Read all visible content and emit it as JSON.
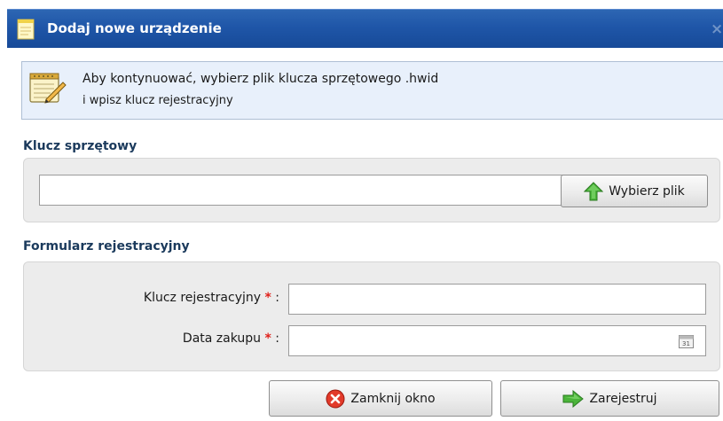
{
  "dialog": {
    "title": "Dodaj nowe urządzenie",
    "close_glyph": "×"
  },
  "info": {
    "line1": "Aby kontynuować, wybierz plik klucza sprzętowego .hwid",
    "line2": "i wpisz klucz rejestracyjny",
    "icon": "notepad-pencil-icon"
  },
  "hardware_key": {
    "section_title": "Klucz sprzętowy",
    "file_value": "",
    "choose_file_label": "Wybierz plik",
    "choose_file_icon": "green-up-arrow-icon"
  },
  "registration": {
    "section_title": "Formularz rejestracyjny",
    "key_label": "Klucz rejestracyjny",
    "key_value": "",
    "purchase_date_label": "Data zakupu",
    "purchase_date_value": "",
    "required_marker": "*",
    "separator": ":",
    "calendar_icon": "calendar-icon",
    "calendar_day": "31"
  },
  "footer": {
    "close_label": "Zamknij okno",
    "close_icon": "red-x-circle-icon",
    "register_label": "Zarejestruj",
    "register_icon": "green-right-arrow-icon"
  },
  "colors": {
    "titlebar": "#1f56a8",
    "info_bg": "#e8f0fb",
    "required": "#e0211b",
    "section_title": "#1b3a5c"
  }
}
